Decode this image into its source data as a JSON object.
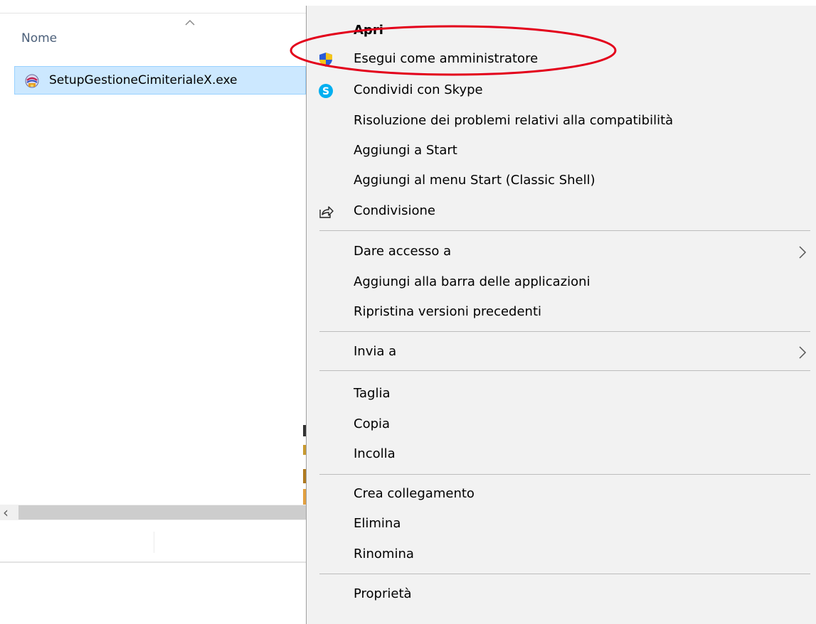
{
  "explorer": {
    "column_header": "Nome",
    "file_name": "SetupGestioneCimiterialeX.exe",
    "scroll_left_glyph": "‹",
    "icons": {
      "file": "setup-exe-icon",
      "sort": "sort-ascending-icon"
    }
  },
  "context_menu": {
    "items": [
      {
        "label": "Apri",
        "bold": true
      },
      {
        "label": "Esegui come amministratore",
        "icon": "uac-shield-icon"
      },
      {
        "label": "Condividi con Skype",
        "icon": "skype-icon"
      },
      {
        "label": "Risoluzione dei problemi relativi alla compatibilità"
      },
      {
        "label": "Aggiungi a Start"
      },
      {
        "label": "Aggiungi al menu Start (Classic Shell)"
      },
      {
        "label": "Condivisione",
        "icon": "share-icon"
      },
      {
        "label": "Dare accesso a",
        "submenu": true
      },
      {
        "label": "Aggiungi alla barra delle applicazioni"
      },
      {
        "label": "Ripristina versioni precedenti"
      },
      {
        "label": "Invia a",
        "submenu": true
      },
      {
        "label": "Taglia"
      },
      {
        "label": "Copia"
      },
      {
        "label": "Incolla"
      },
      {
        "label": "Crea collegamento"
      },
      {
        "label": "Elimina"
      },
      {
        "label": "Rinomina"
      },
      {
        "label": "Proprietà"
      }
    ]
  },
  "colors": {
    "selection": "#cce8ff",
    "menu_bg": "#f2f2f2",
    "highlight_ellipse": "#e3001b",
    "shield_blue": "#2a5bd7",
    "shield_yellow": "#f5c518",
    "skype_blue": "#00aff0"
  }
}
